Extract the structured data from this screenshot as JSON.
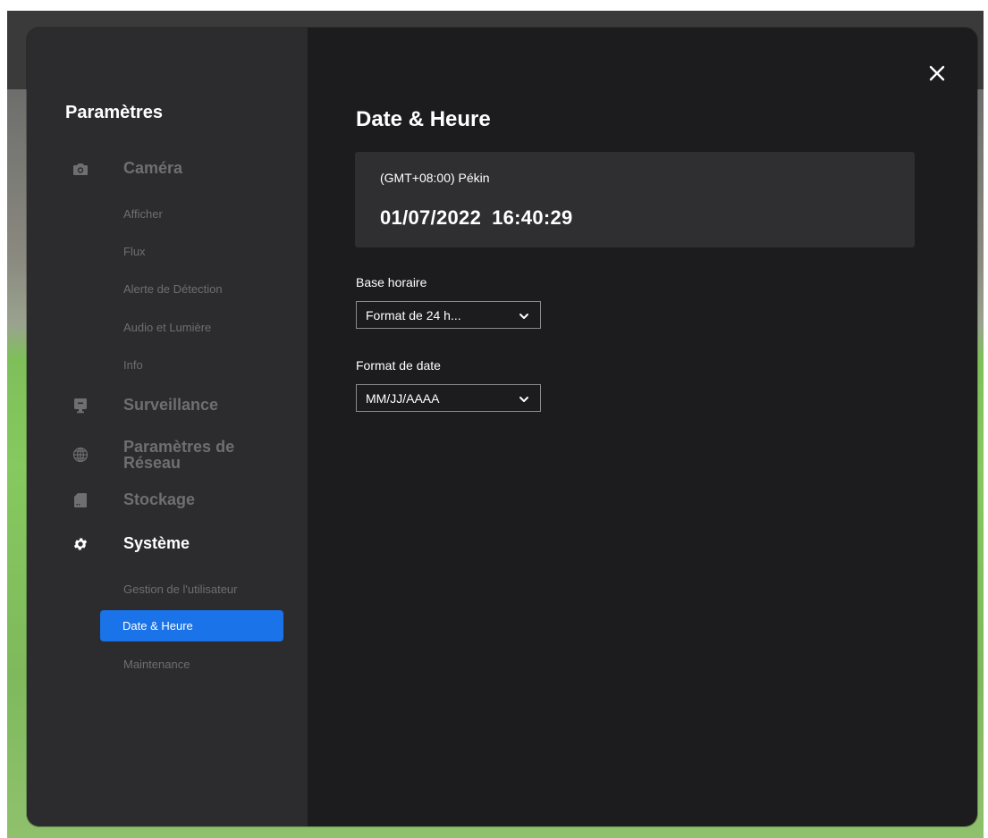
{
  "sidebar": {
    "title": "Paramètres",
    "sections": [
      {
        "label": "Caméra",
        "icon": "camera-icon"
      },
      {
        "label": "Surveillance",
        "icon": "monitor-icon"
      },
      {
        "label": "Paramètres de Réseau",
        "label_line1": "Paramètres de",
        "label_line2": "Réseau",
        "icon": "globe-icon"
      },
      {
        "label": "Stockage",
        "icon": "sd-card-icon"
      },
      {
        "label": "Système",
        "icon": "gear-icon",
        "active": true
      }
    ],
    "camera_items": [
      "Afficher",
      "Flux",
      "Alerte de Détection",
      "Audio et Lumière",
      "Info"
    ],
    "system_items": [
      "Gestion de l'utilisateur",
      "Date & Heure",
      "Maintenance"
    ],
    "selected_item": "Date & Heure"
  },
  "content": {
    "title": "Date & Heure",
    "timezone": "(GMT+08:00) Pékin",
    "date": "01/07/2022",
    "time": "16:40:29",
    "time_format": {
      "label": "Base horaire",
      "value": "Format de 24 h..."
    },
    "date_format": {
      "label": "Format de date",
      "value": "MM/JJ/AAAA"
    },
    "close_icon": "close-icon"
  },
  "colors": {
    "accent": "#1a73e8",
    "sidebar_bg": "#2c2c2e",
    "content_bg": "#1c1c1e",
    "muted_text": "#6e6e73"
  }
}
